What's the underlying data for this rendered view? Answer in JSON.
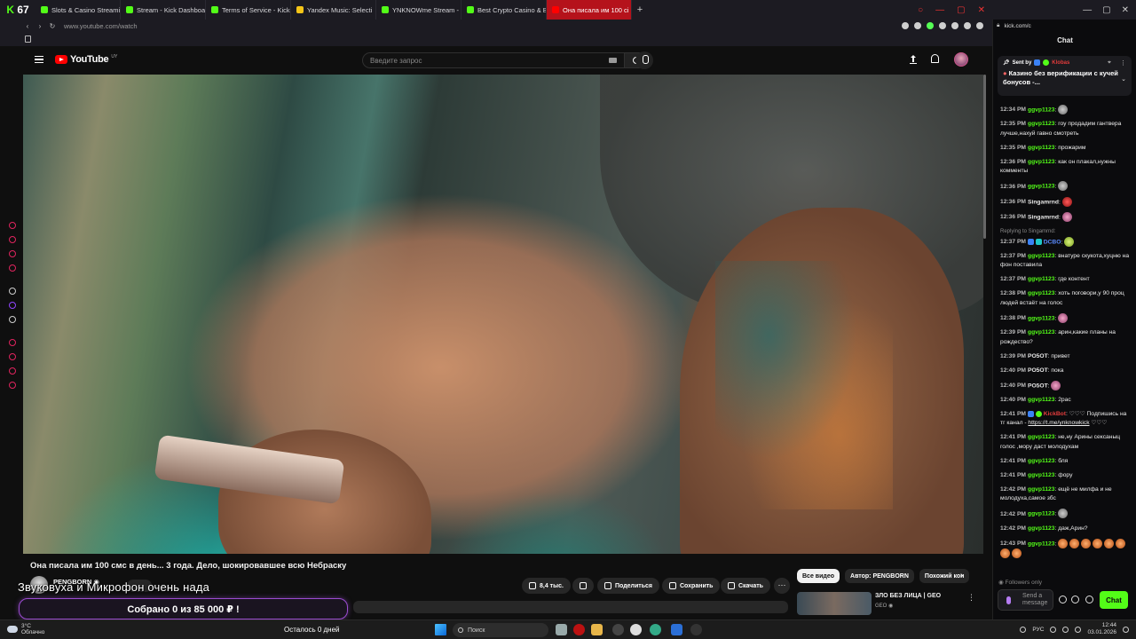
{
  "browser": {
    "logo": "67",
    "tabs": [
      {
        "label": "Slots & Casino Streaming",
        "color": "#53fc18"
      },
      {
        "label": "Stream - Kick Dashboard",
        "color": "#53fc18"
      },
      {
        "label": "Terms of Service - Kick St",
        "color": "#53fc18"
      },
      {
        "label": "Yandex Music: Selecti",
        "color": "#f5c518"
      },
      {
        "label": "YNKNOWme Stream - We",
        "color": "#53fc18"
      },
      {
        "label": "Best Crypto Casino & Bitc",
        "color": "#53fc18"
      },
      {
        "label": "Она писала им 100 сі",
        "color": "#ff0000"
      }
    ],
    "url": "www.youtube.com/watch",
    "chat_url": "kick.com/c"
  },
  "youtube": {
    "logo_text": "YouTube",
    "region": "UY",
    "search_placeholder": "Введите запрос",
    "video_title": "Она писала им 100 смс в день... 3 года. Дело, шокировавшее всю Небраску",
    "channel_name": "PENGBORN ◉",
    "actions": {
      "likes": "8,4 тыс.",
      "share": "Поделиться",
      "save": "Сохранить",
      "download": "Скачать",
      "more": "···"
    },
    "chips": [
      "Все видео",
      "Автор: PENGBORN",
      "Похожий кон"
    ],
    "recommended": {
      "title": "ЗЛО БЕЗ ЛИЦА | GEO",
      "channel": "GEO ◉"
    }
  },
  "overlay": {
    "caption": "Звуковуха и Микрофон очень нада",
    "donation_label": "Собрано 0  из 85 000 ₽ !",
    "donation_progress": 0
  },
  "chat": {
    "title": "Chat",
    "pinned": {
      "sent_by": "Sent by",
      "user": "Klobas",
      "message": "Казино без верификации с кучей бонусов -..."
    },
    "messages": [
      {
        "time": "12:34 PM",
        "user": "ggvp1123",
        "user_color": "green",
        "text": "",
        "emote": "grey"
      },
      {
        "time": "12:35 PM",
        "user": "ggvp1123",
        "user_color": "green",
        "text": "гоу продадим гантвера лучше,нахуй гавно смотреть"
      },
      {
        "time": "12:35 PM",
        "user": "ggvp1123",
        "user_color": "green",
        "text": "прожарим"
      },
      {
        "time": "12:36 PM",
        "user": "ggvp1123",
        "user_color": "green",
        "text": "как он плакал,нужны комменты"
      },
      {
        "time": "12:36 PM",
        "user": "ggvp1123",
        "user_color": "green",
        "text": "",
        "emote": "grey"
      },
      {
        "time": "12:36 PM",
        "user": "Singamrnd",
        "user_color": "white",
        "text": "",
        "emote": "red"
      },
      {
        "time": "12:36 PM",
        "user": "Singamrnd",
        "user_color": "white",
        "text": "",
        "emote": "pink"
      },
      {
        "time": "12:37 PM",
        "user": "DCBO",
        "user_color": "blue",
        "reply": "Replying to Singamrnd:",
        "text": "",
        "emote": "yel"
      },
      {
        "time": "12:37 PM",
        "user": "ggvp1123",
        "user_color": "green",
        "text": "внатуре скукота,хуцню на фон поставила"
      },
      {
        "time": "12:37 PM",
        "user": "ggvp1123",
        "user_color": "green",
        "text": "где контент"
      },
      {
        "time": "12:38 PM",
        "user": "ggvp1123",
        "user_color": "green",
        "text": "хоть поговори,у 90 проц людей встаёт на голос"
      },
      {
        "time": "12:38 PM",
        "user": "ggvp1123",
        "user_color": "green",
        "text": "",
        "emote": "pink"
      },
      {
        "time": "12:39 PM",
        "user": "ggvp1123",
        "user_color": "green",
        "text": "арин,какие планы на рождество?"
      },
      {
        "time": "12:39 PM",
        "user": "PO5OT",
        "user_color": "white",
        "text": "привет"
      },
      {
        "time": "12:40 PM",
        "user": "PO5OT",
        "user_color": "white",
        "text": "пока"
      },
      {
        "time": "12:40 PM",
        "user": "PO5OT",
        "user_color": "white",
        "text": "",
        "emote": "pink"
      },
      {
        "time": "12:40 PM",
        "user": "ggvp1123",
        "user_color": "green",
        "text": "2рас"
      },
      {
        "time": "12:41 PM",
        "user": "KickBot",
        "user_color": "red",
        "text": "♡♡♡ Подпишись на тг канал - ",
        "link": "https://t.me/ynknowkick",
        "suffix": " ♡♡♡"
      },
      {
        "time": "12:41 PM",
        "user": "ggvp1123",
        "user_color": "green",
        "text": "не,ну Арины сексаныц голос ,мору даст молодухам"
      },
      {
        "time": "12:41 PM",
        "user": "ggvp1123",
        "user_color": "green",
        "text": "бля"
      },
      {
        "time": "12:41 PM",
        "user": "ggvp1123",
        "user_color": "green",
        "text": "фору"
      },
      {
        "time": "12:42 PM",
        "user": "ggvp1123",
        "user_color": "green",
        "text": "ещё не милфа и не молодуха,самое збс"
      },
      {
        "time": "12:42 PM",
        "user": "ggvp1123",
        "user_color": "green",
        "text": "",
        "emote": "grey"
      },
      {
        "time": "12:42 PM",
        "user": "ggvp1123",
        "user_color": "green",
        "text": "даж,Арин?"
      },
      {
        "time": "12:43 PM",
        "user": "ggvp1123",
        "user_color": "green",
        "text": "",
        "emote": "orange",
        "emote_count": 8
      }
    ],
    "followers_only": "Followers only",
    "input_placeholder": "Send a message",
    "send_label": "Chat"
  },
  "taskbar": {
    "weather_temp": "3°C",
    "weather_desc": "Облачно",
    "center_text": "Осталось 0 дней",
    "search_label": "Поиск",
    "lang": "РУС",
    "time": "12:44",
    "date": "03.01.2026"
  }
}
